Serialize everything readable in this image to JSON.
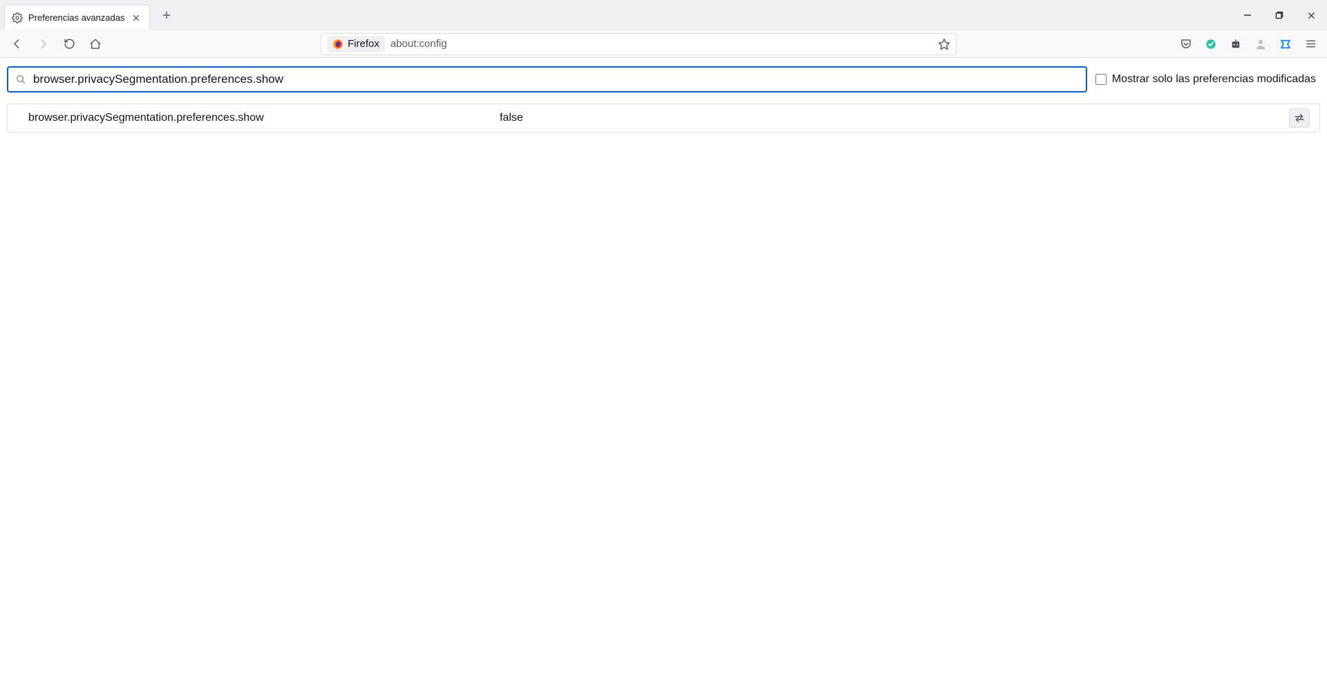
{
  "tab": {
    "title": "Preferencias avanzadas"
  },
  "urlbar": {
    "identity_label": "Firefox",
    "url": "about:config"
  },
  "config": {
    "search_value": "browser.privacySegmentation.preferences.show",
    "show_only_modified_label": "Mostrar solo las preferencias modificadas",
    "show_only_modified_checked": false,
    "rows": [
      {
        "name": "browser.privacySegmentation.preferences.show",
        "value": "false"
      }
    ]
  },
  "icons": {
    "gear": "gear-icon",
    "close": "close-icon",
    "plus": "plus-icon",
    "minimize": "minimize-icon",
    "maximize": "maximize-icon",
    "window_close": "window-close-icon",
    "back": "back-icon",
    "forward": "forward-icon",
    "reload": "reload-icon",
    "home": "home-icon",
    "firefox": "firefox-logo-icon",
    "bookmark_star": "bookmark-star-icon",
    "pocket": "pocket-icon",
    "ext_green_circle": "extension-green-circle-icon",
    "ext_robot": "extension-robot-icon",
    "account": "account-icon",
    "ext_blue": "extension-blue-icon",
    "app_menu": "hamburger-menu-icon",
    "search": "search-icon",
    "toggle": "toggle-arrows-icon"
  }
}
